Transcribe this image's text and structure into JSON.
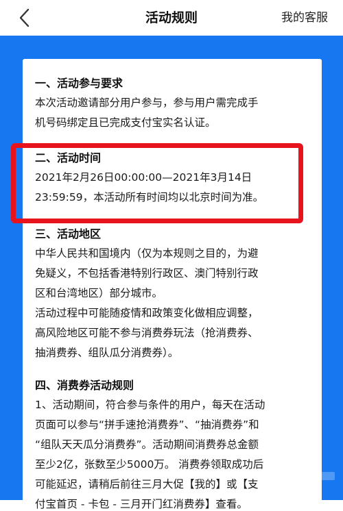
{
  "header": {
    "title": "活动规则",
    "service_label": "我的客服",
    "back_icon": "chevron-left-icon"
  },
  "colors": {
    "background_blue": "#1677f0",
    "highlight_red": "#e8141d",
    "card_white": "#ffffff"
  },
  "rules": {
    "section1": {
      "title": "一、活动参与要求",
      "lines": [
        "本次活动邀请部分用户参与，参与用户需完成手",
        "机号码绑定且已完成支付宝实名认证。"
      ]
    },
    "section2": {
      "title": "二、活动时间",
      "lines": [
        "2021年2月26日00:00:00—2021年3月14日",
        "23:59:59，本活动所有时间均以北京时间为准。"
      ]
    },
    "section3": {
      "title": "三、活动地区",
      "lines": [
        "中华人民共和国境内（仅为本规则之目的，为避",
        "免疑义，不包括香港特别行政区、澳门特别行政",
        "区和台湾地区）部分城市。",
        "活动过程中可能随疫情和政策变化做相应调整，",
        "高风险地区可能不参与消费券玩法（抢消费券、",
        "抽消费券、组队瓜分消费券）。"
      ]
    },
    "section4": {
      "title": "四、消费券活动规则",
      "lines": [
        "1、活动期间，符合参与条件的用户，每天在活动",
        "页面可以参与“拼手速抢消费券”、“抽消费券”和",
        "“组队天天瓜分消费券”。活动期间消费券总金额",
        "至少2亿，张数至少5000万。 消费券领取成功后",
        "可能延迟，请稍后前往三月大促【我的】或【支",
        "付宝首页 - 卡包 - 三月开门红消费券】查看。"
      ]
    }
  }
}
